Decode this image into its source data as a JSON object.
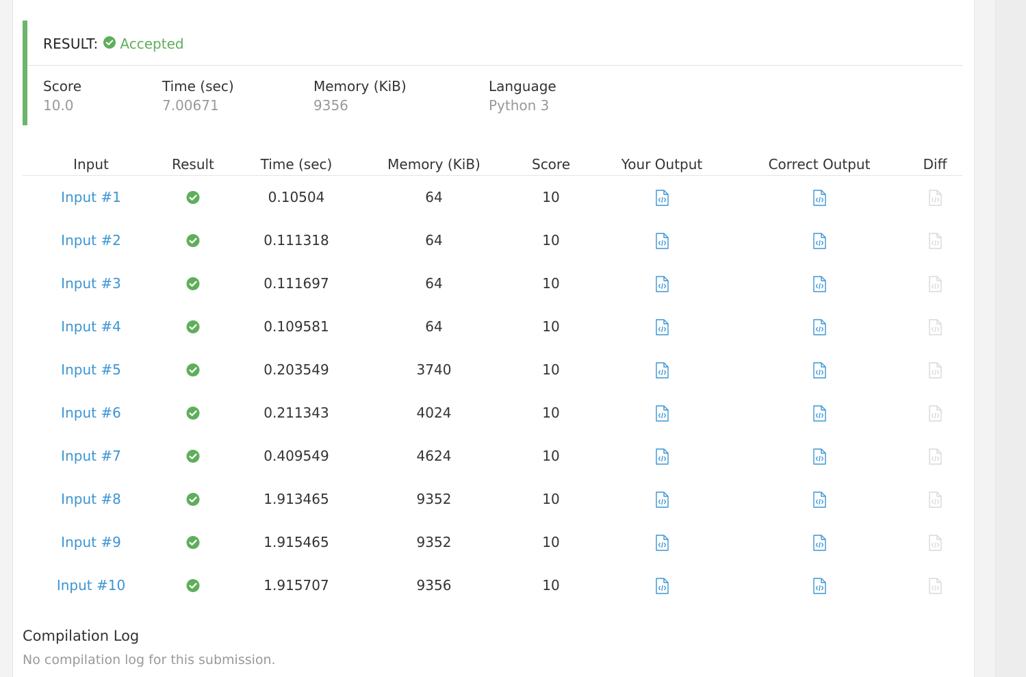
{
  "result": {
    "label": "RESULT:",
    "status": "Accepted",
    "status_color": "#5fae5b",
    "accent_color": "#6cb56a"
  },
  "stats": [
    {
      "key": "Score",
      "value": "10.0"
    },
    {
      "key": "Time (sec)",
      "value": "7.00671"
    },
    {
      "key": "Memory (KiB)",
      "value": "9356"
    },
    {
      "key": "Language",
      "value": "Python 3"
    }
  ],
  "table": {
    "headers": [
      "Input",
      "Result",
      "Time (sec)",
      "Memory (KiB)",
      "Score",
      "Your Output",
      "Correct Output",
      "Diff"
    ],
    "rows": [
      {
        "input": "Input #1",
        "time": "0.10504",
        "memory": "64",
        "score": "10"
      },
      {
        "input": "Input #2",
        "time": "0.111318",
        "memory": "64",
        "score": "10"
      },
      {
        "input": "Input #3",
        "time": "0.111697",
        "memory": "64",
        "score": "10"
      },
      {
        "input": "Input #4",
        "time": "0.109581",
        "memory": "64",
        "score": "10"
      },
      {
        "input": "Input #5",
        "time": "0.203549",
        "memory": "3740",
        "score": "10"
      },
      {
        "input": "Input #6",
        "time": "0.211343",
        "memory": "4024",
        "score": "10"
      },
      {
        "input": "Input #7",
        "time": "0.409549",
        "memory": "4624",
        "score": "10"
      },
      {
        "input": "Input #8",
        "time": "1.913465",
        "memory": "9352",
        "score": "10"
      },
      {
        "input": "Input #9",
        "time": "1.915465",
        "memory": "9352",
        "score": "10"
      },
      {
        "input": "Input #10",
        "time": "1.915707",
        "memory": "9356",
        "score": "10"
      }
    ],
    "result_icon": "check-circle-icon",
    "output_icon": "code-file-icon",
    "diff_icon": "code-file-icon-disabled"
  },
  "compilation": {
    "title": "Compilation Log",
    "text": "No compilation log for this submission."
  }
}
